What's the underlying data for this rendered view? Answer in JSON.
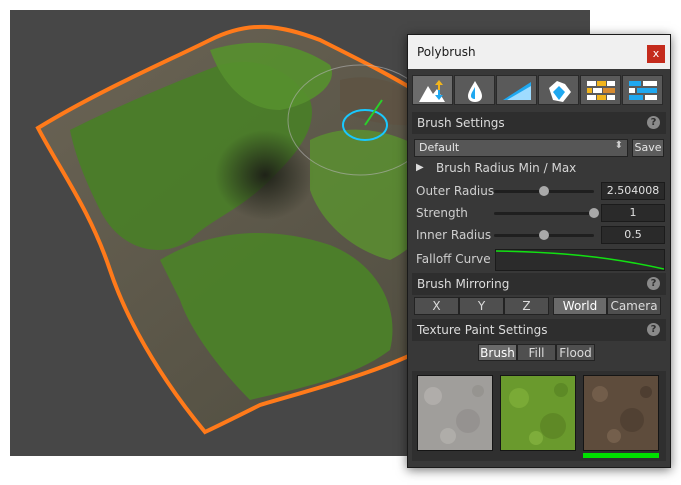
{
  "panel": {
    "title": "Polybrush",
    "close_label": "x",
    "tools": [
      {
        "name": "raise-lower-sculpt",
        "icon": "mountain-arrows-icon",
        "active": true
      },
      {
        "name": "smooth",
        "icon": "droplet-icon",
        "active": false
      },
      {
        "name": "sculpt-ramp",
        "icon": "blue-ramp-icon",
        "active": false
      },
      {
        "name": "paint-vertex-color",
        "icon": "crystal-brush-icon",
        "active": false
      },
      {
        "name": "paint-texture",
        "icon": "brick-texture-icon",
        "active": false
      },
      {
        "name": "scatter-prefabs",
        "icon": "blue-grid-icon",
        "active": false
      }
    ],
    "brush_settings": {
      "header": "Brush Settings",
      "help": "?",
      "preset": "Default",
      "dropdown_arrow": "⬍",
      "save_label": "Save",
      "foldout_label": "Brush Radius Min / Max",
      "foldout_icon": "▶",
      "outer_radius": {
        "label": "Outer Radius",
        "value": "2.504008",
        "slider_fraction": 0.5
      },
      "strength": {
        "label": "Strength",
        "value": "1",
        "slider_fraction": 1.0
      },
      "inner_radius": {
        "label": "Inner Radius",
        "value": "0.5",
        "slider_fraction": 0.5
      },
      "falloff_label": "Falloff Curve"
    },
    "brush_mirroring": {
      "header": "Brush Mirroring",
      "help": "?",
      "axes": [
        "X",
        "Y",
        "Z"
      ],
      "spaces": [
        "World",
        "Camera"
      ],
      "selected_space": "World"
    },
    "texture_paint": {
      "header": "Texture Paint Settings",
      "help": "?",
      "modes": [
        "Brush",
        "Fill",
        "Flood"
      ],
      "selected_mode": "Brush",
      "textures": [
        "stone-texture",
        "grass-texture",
        "dirt-texture"
      ],
      "selected_texture_index": 2,
      "selection_color": "#00e000"
    }
  },
  "colors": {
    "viewport_bg": "#474747",
    "terrain_outline": "#ff7a1a",
    "grass": "#4f8a2a",
    "brush_ring": "#19c8ff"
  }
}
